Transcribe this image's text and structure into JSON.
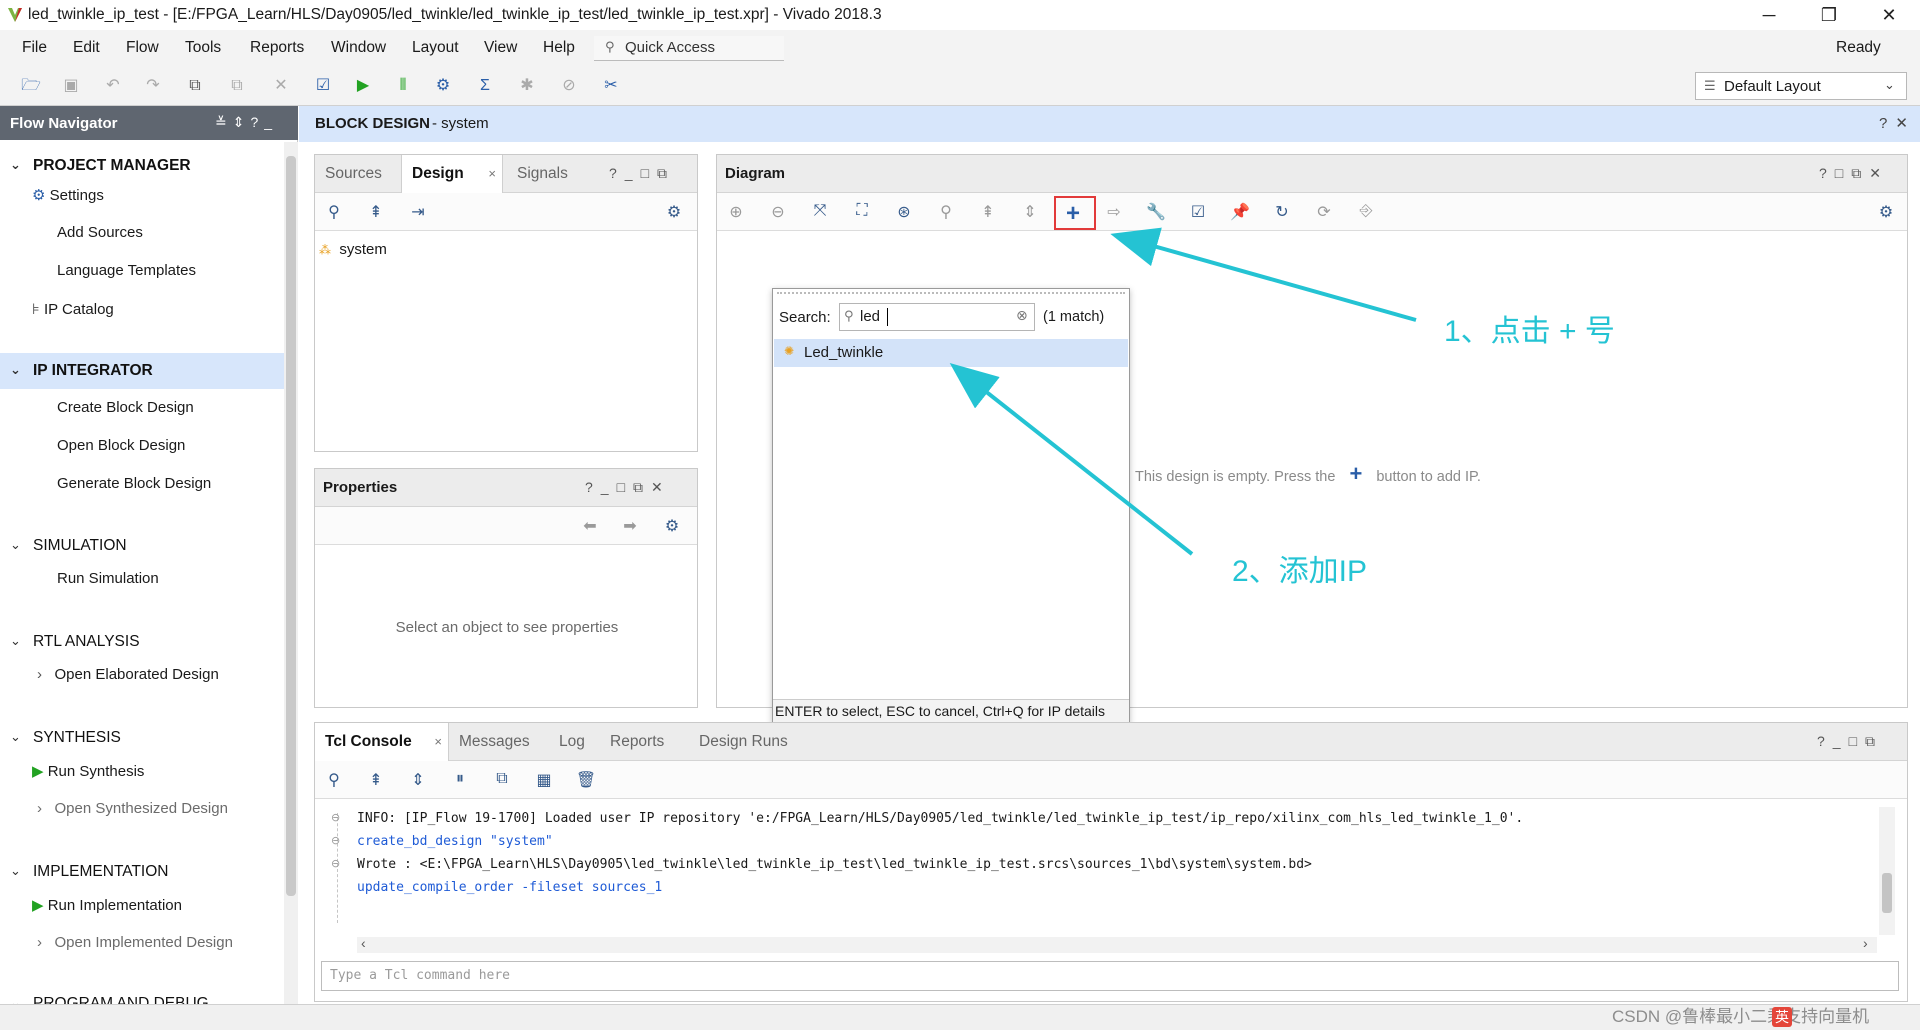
{
  "window": {
    "title": "led_twinkle_ip_test - [E:/FPGA_Learn/HLS/Day0905/led_twinkle/led_twinkle_ip_test/led_twinkle_ip_test.xpr] - Vivado 2018.3",
    "status": "Ready"
  },
  "menu": {
    "file": "File",
    "edit": "Edit",
    "flow": "Flow",
    "tools": "Tools",
    "reports": "Reports",
    "window": "Window",
    "layout": "Layout",
    "view": "View",
    "help": "Help",
    "quick_access": "Quick Access"
  },
  "layout_select": {
    "value": "Default Layout"
  },
  "flow_navigator": {
    "title": "Flow Navigator",
    "project_manager": {
      "label": "PROJECT MANAGER",
      "settings": "Settings",
      "add_sources": "Add Sources",
      "language_templates": "Language Templates",
      "ip_catalog": "IP Catalog"
    },
    "ip_integrator": {
      "label": "IP INTEGRATOR",
      "create": "Create Block Design",
      "open": "Open Block Design",
      "generate": "Generate Block Design"
    },
    "simulation": {
      "label": "SIMULATION",
      "run": "Run Simulation"
    },
    "rtl_analysis": {
      "label": "RTL ANALYSIS",
      "open": "Open Elaborated Design"
    },
    "synthesis": {
      "label": "SYNTHESIS",
      "run": "Run Synthesis",
      "open": "Open Synthesized Design"
    },
    "implementation": {
      "label": "IMPLEMENTATION",
      "run": "Run Implementation",
      "open": "Open Implemented Design"
    },
    "program": {
      "label": "PROGRAM AND DEBUG"
    }
  },
  "block_design": {
    "title": "BLOCK DESIGN",
    "name": "- system"
  },
  "sources": {
    "tab_sources": "Sources",
    "tab_design": "Design",
    "tab_signals": "Signals",
    "tree_item": "system"
  },
  "properties": {
    "title": "Properties",
    "empty": "Select an object to see properties"
  },
  "diagram": {
    "title": "Diagram",
    "empty_msg_1": "This design is empty. Press the",
    "empty_msg_2": "button to add IP."
  },
  "popup": {
    "search_label": "Search:",
    "search_value": "led",
    "match_count": "(1 match)",
    "result": "Led_twinkle",
    "footer": "ENTER to select, ESC to cancel, Ctrl+Q for IP details"
  },
  "annotations": {
    "step1": "1、点击 + 号",
    "step2": "2、添加IP"
  },
  "tcl": {
    "tab_console": "Tcl Console",
    "tab_messages": "Messages",
    "tab_log": "Log",
    "tab_reports": "Reports",
    "tab_runs": "Design Runs",
    "lines": [
      "INFO: [IP_Flow 19-1700] Loaded user IP repository 'e:/FPGA_Learn/HLS/Day0905/led_twinkle/led_twinkle_ip_test/ip_repo/xilinx_com_hls_led_twinkle_1_0'.",
      "create_bd_design \"system\"",
      "Wrote  : <E:\\FPGA_Learn\\HLS\\Day0905\\led_twinkle\\led_twinkle_ip_test\\led_twinkle_ip_test.srcs\\sources_1\\bd\\system\\system.bd>",
      "update_compile_order -fileset sources_1"
    ],
    "input_placeholder": "Type a Tcl command here"
  },
  "watermark": "CSDN @鲁棒最小二乘支持向量机",
  "ime": "英"
}
